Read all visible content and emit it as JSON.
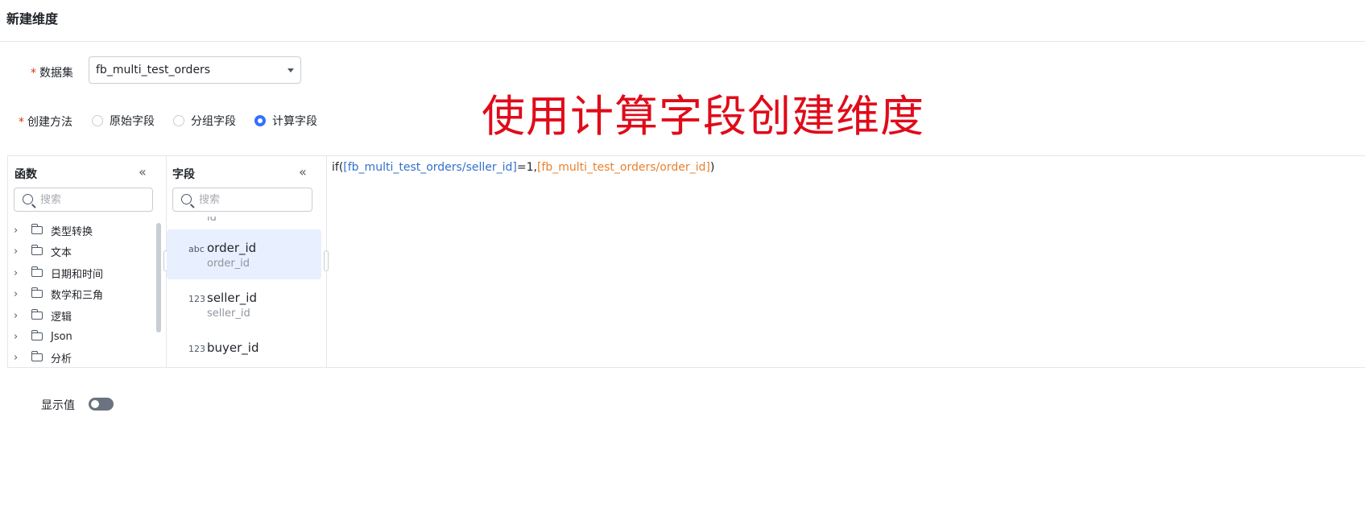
{
  "header": {
    "title": "新建维度"
  },
  "form": {
    "dataset": {
      "label": "数据集",
      "value": "fb_multi_test_orders"
    },
    "method": {
      "label": "创建方法",
      "options": [
        {
          "label": "原始字段",
          "checked": false
        },
        {
          "label": "分组字段",
          "checked": false
        },
        {
          "label": "计算字段",
          "checked": true
        }
      ]
    },
    "display_value": {
      "label": "显示值",
      "enabled": false
    }
  },
  "annotation": {
    "text": "使用计算字段创建维度",
    "color": "#e00b1a"
  },
  "functions_panel": {
    "title": "函数",
    "search_placeholder": "搜索",
    "categories": [
      "类型转换",
      "文本",
      "日期和时间",
      "数学和三角",
      "逻辑",
      "Json",
      "分析"
    ]
  },
  "fields_panel": {
    "title": "字段",
    "search_placeholder": "搜索",
    "partial_item_alias": "id",
    "items": [
      {
        "type": "abc",
        "name": "order_id",
        "alias": "order_id",
        "selected": true
      },
      {
        "type": "123",
        "name": "seller_id",
        "alias": "seller_id",
        "selected": false
      },
      {
        "type": "123",
        "name": "buyer_id",
        "alias": "",
        "selected": false
      }
    ]
  },
  "editor": {
    "tokens": [
      "if(",
      "[fb_multi_test_orders/seller_id]",
      "=1,",
      "[fb_multi_test_orders/order_id]",
      ")"
    ]
  },
  "colors": {
    "accent": "#3370ff",
    "selected_bg": "#e8effe",
    "field_ref_blue": "#3370cc",
    "field_ref_orange": "#e9812e"
  }
}
